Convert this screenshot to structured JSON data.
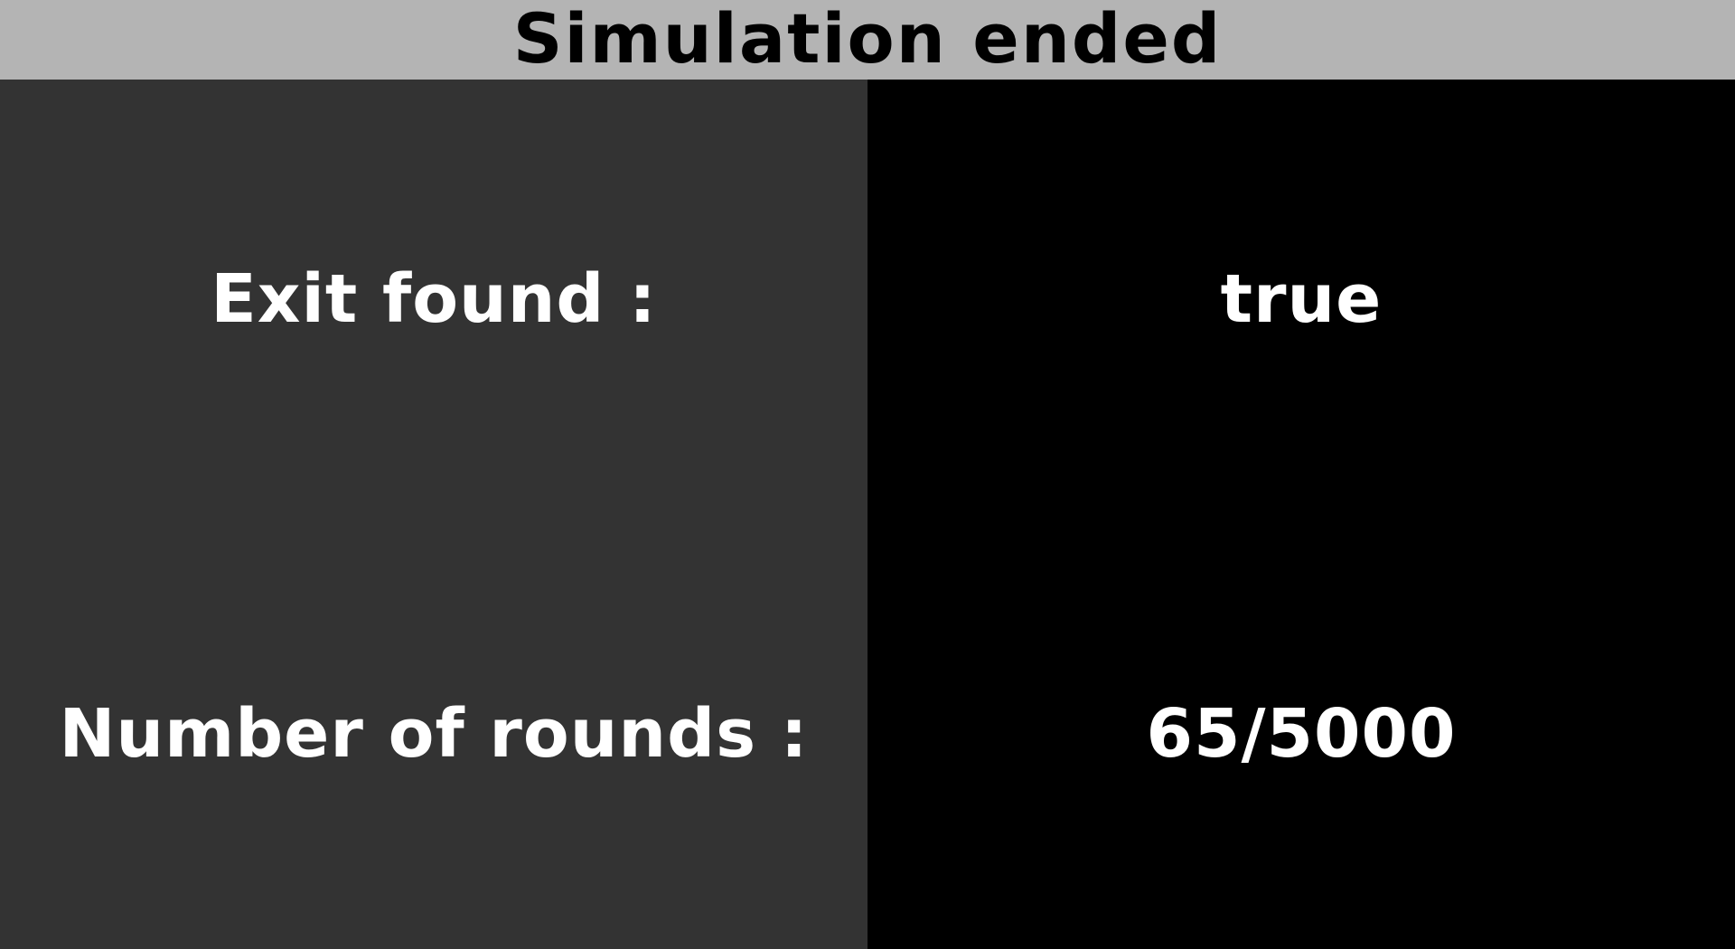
{
  "header": {
    "title": "Simulation ended"
  },
  "results": {
    "rows": [
      {
        "label": "Exit found :",
        "value": "true"
      },
      {
        "label": "Number of rounds :",
        "value": "65/5000"
      }
    ]
  },
  "colors": {
    "header_bg": "#b4b4b4",
    "label_panel_bg": "#333333",
    "value_panel_bg": "#000000",
    "text_light": "#ffffff",
    "text_dark": "#000000"
  }
}
